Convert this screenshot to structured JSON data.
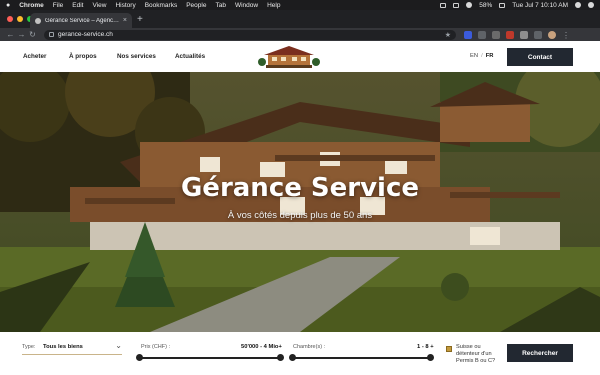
{
  "menubar": {
    "items": [
      "Chrome",
      "File",
      "Edit",
      "View",
      "History",
      "Bookmarks",
      "People",
      "Tab",
      "Window",
      "Help"
    ],
    "battery": "58%",
    "clock": "Tue Jul 7  10:10 AM"
  },
  "browser": {
    "tab_title": "Gérance Service – Agence imm",
    "url": "gerance-service.ch"
  },
  "site": {
    "nav": {
      "acheter": "Acheter",
      "apropos": "À propos",
      "services": "Nos services",
      "actualites": "Actualités"
    },
    "logo_text": "GÉRANCE SERVICE",
    "lang": {
      "en": "EN",
      "sep": "/",
      "fr": "FR"
    },
    "contact_label": "Contact",
    "hero": {
      "title": "Gérance Service",
      "subtitle": "À vos côtés depuis plus de 50 ans"
    },
    "search": {
      "type_label": "Type:",
      "type_value": "Tous les biens",
      "price_label": "Prix (CHF) :",
      "price_value": "50'000 - 4 Mio+",
      "rooms_label": "Chambre(s) :",
      "rooms_value": "1 - 8 +",
      "permit_text": "Suisse ou détenteur d'un Permis B ou C?",
      "submit_label": "Rechercher"
    }
  },
  "colors": {
    "dark_button": "#222831",
    "accent_gold": "#c49a3c"
  }
}
